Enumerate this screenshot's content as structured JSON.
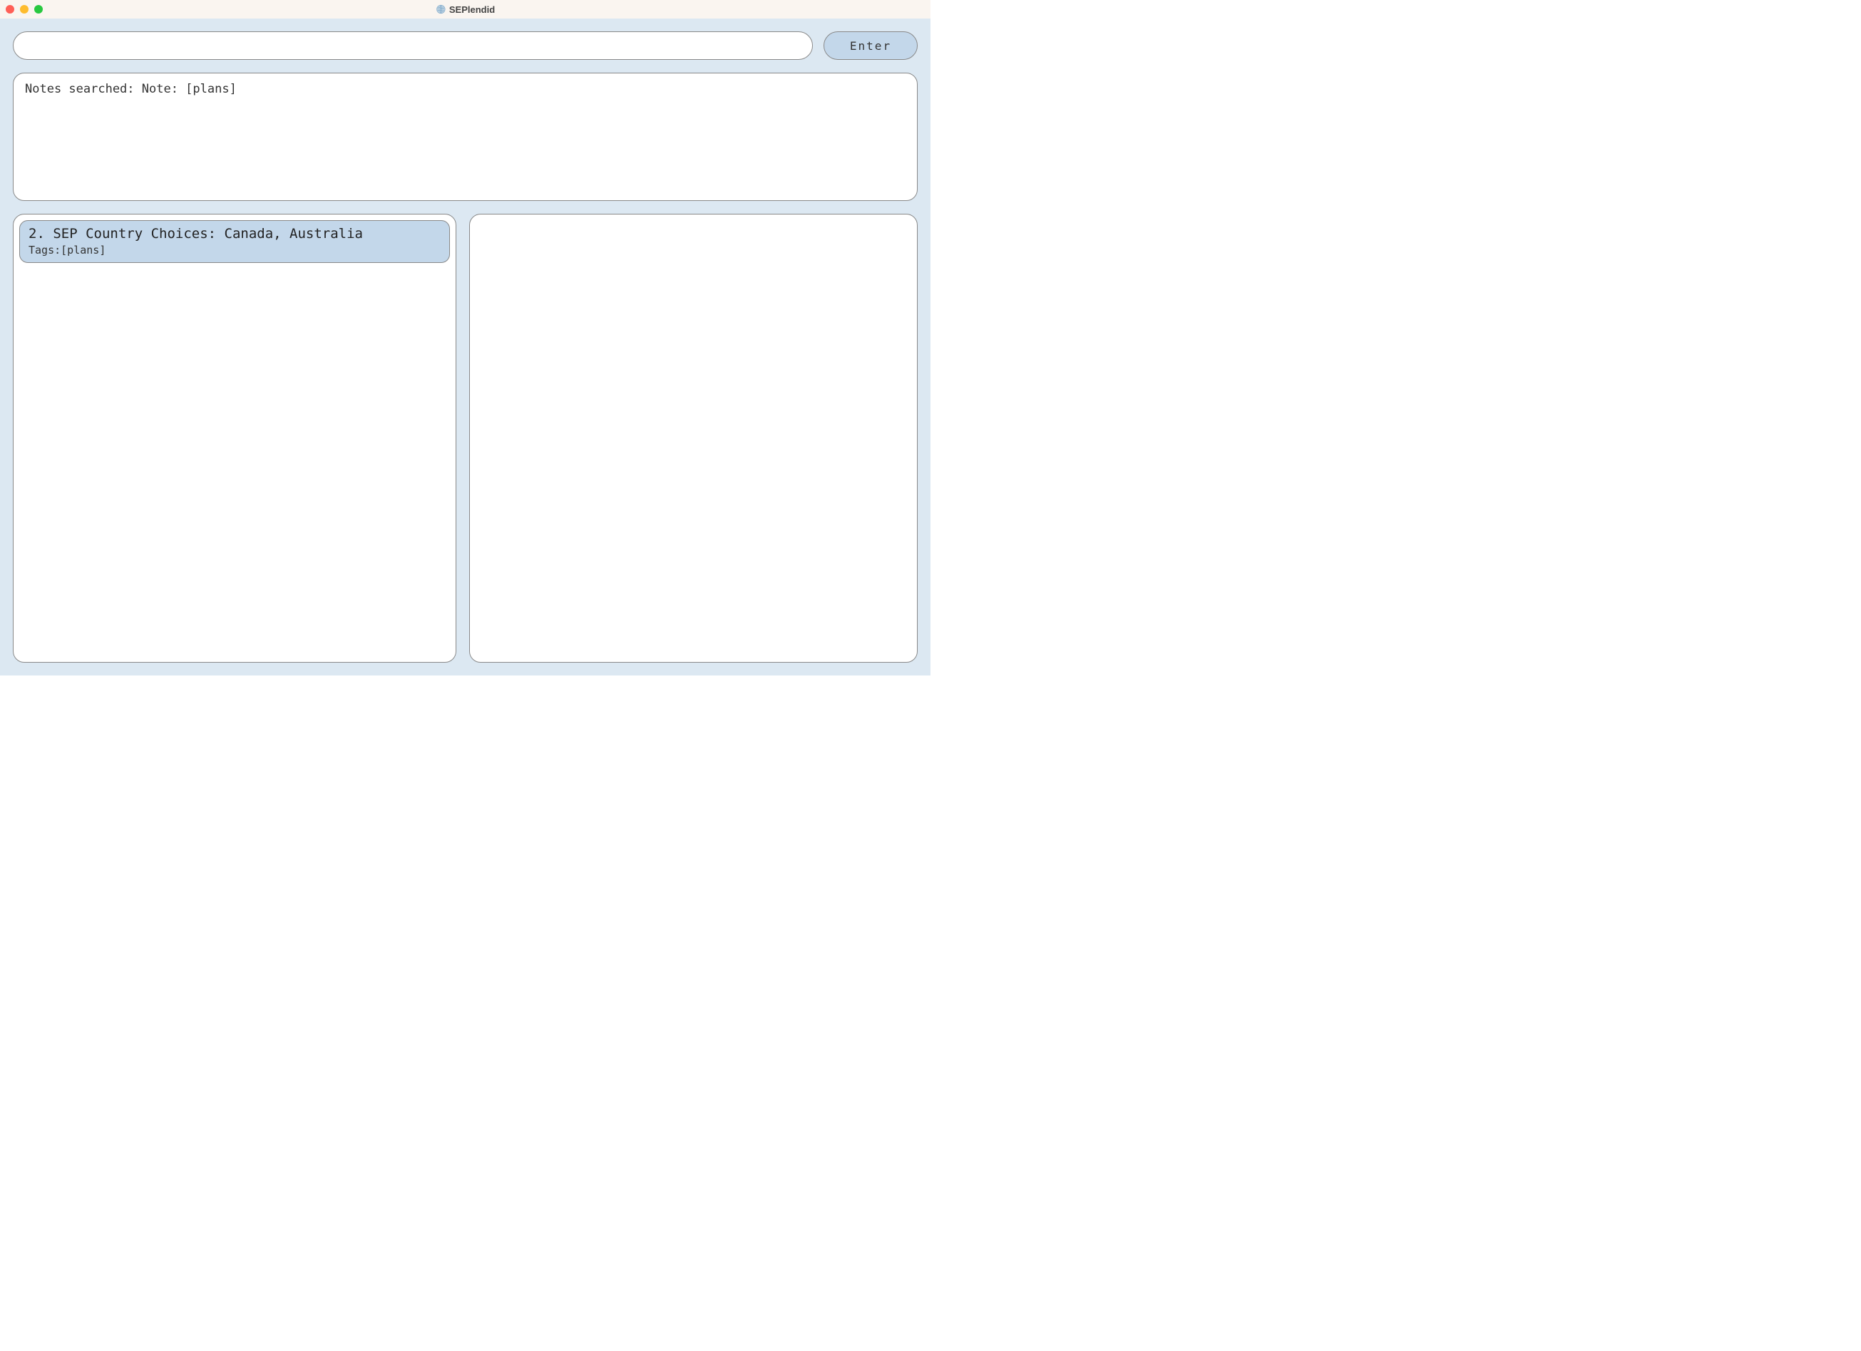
{
  "window": {
    "title": "SEPlendid"
  },
  "input": {
    "value": "",
    "placeholder": ""
  },
  "buttons": {
    "enter": "Enter"
  },
  "status": {
    "message": "Notes searched: Note: [plans]"
  },
  "notes": [
    {
      "title": "2. SEP Country Choices: Canada, Australia",
      "tags_label": "Tags:[plans]"
    }
  ],
  "detail": {
    "content": ""
  }
}
